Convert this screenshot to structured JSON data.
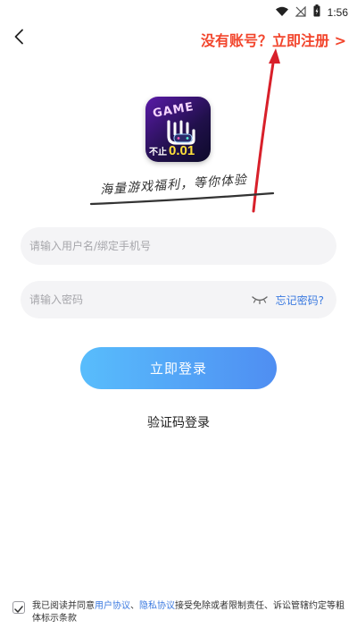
{
  "status_bar": {
    "time": "1:56",
    "icons": [
      "wifi-icon",
      "signal-off-icon",
      "battery-charging-icon"
    ]
  },
  "header": {
    "back_icon": "chevron-left-icon",
    "register_link": "没有账号？立即注册 >"
  },
  "brand": {
    "logo_text": "GAME",
    "logo_badge_cn": "不止",
    "logo_badge_num": "0.01",
    "slogan": "海量游戏福利，等你体验"
  },
  "form": {
    "username_placeholder": "请输入用户名/绑定手机号",
    "password_placeholder": "请输入密码",
    "password_toggle_icon": "eye-closed-icon",
    "forgot_password": "忘记密码?",
    "login_button": "立即登录",
    "sms_login": "验证码登录"
  },
  "agreement": {
    "checked": true,
    "prefix": "我已阅读并同意",
    "user_agreement": "用户协议",
    "separator": "、",
    "privacy_agreement": "隐私协议",
    "suffix": "接受免除或者限制责任、诉讼管辖约定等粗体标示条款"
  },
  "colors": {
    "accent_red": "#f2452c",
    "link_blue": "#3b7ae0",
    "button_gradient_start": "#58bdfc",
    "button_gradient_end": "#4f8ef2",
    "field_bg": "#f4f4f6"
  }
}
